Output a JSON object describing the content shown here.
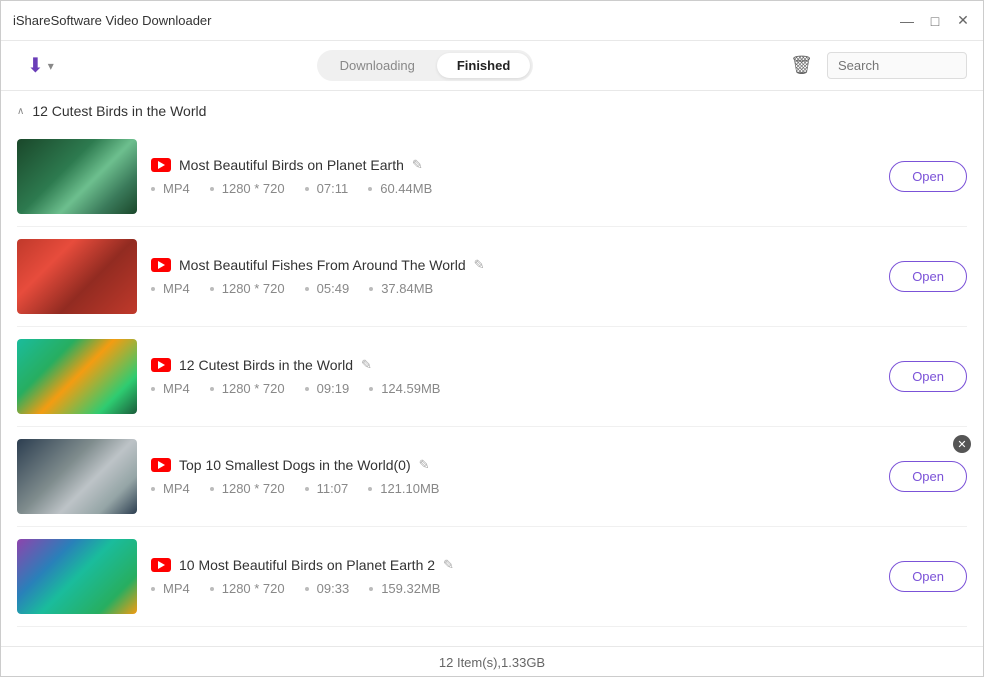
{
  "app": {
    "title": "iShareSoftware Video Downloader"
  },
  "titlebar": {
    "minimize": "—",
    "maximize": "□",
    "close": "✕"
  },
  "toolbar": {
    "downloading_label": "Downloading",
    "finished_label": "Finished",
    "active_tab": "finished",
    "search_placeholder": "Search",
    "delete_icon": "🗑"
  },
  "group": {
    "name": "12 Cutest Birds in the World",
    "collapse_icon": "∧"
  },
  "videos": [
    {
      "id": 1,
      "title": "Most Beautiful Birds on Planet Earth",
      "format": "MP4",
      "resolution": "1280 * 720",
      "duration": "07:11",
      "size": "60.44MB",
      "thumb_class": "thumb-1",
      "open_label": "Open"
    },
    {
      "id": 2,
      "title": "Most Beautiful Fishes From Around The World",
      "format": "MP4",
      "resolution": "1280 * 720",
      "duration": "05:49",
      "size": "37.84MB",
      "thumb_class": "thumb-2",
      "open_label": "Open"
    },
    {
      "id": 3,
      "title": "12 Cutest Birds in the World",
      "format": "MP4",
      "resolution": "1280 * 720",
      "duration": "09:19",
      "size": "124.59MB",
      "thumb_class": "thumb-3",
      "open_label": "Open"
    },
    {
      "id": 4,
      "title": "Top 10 Smallest Dogs in the World(0)",
      "format": "MP4",
      "resolution": "1280 * 720",
      "duration": "11:07",
      "size": "121.10MB",
      "thumb_class": "thumb-4",
      "open_label": "Open",
      "show_close": true
    },
    {
      "id": 5,
      "title": "10 Most Beautiful Birds on Planet Earth 2",
      "format": "MP4",
      "resolution": "1280 * 720",
      "duration": "09:33",
      "size": "159.32MB",
      "thumb_class": "thumb-5",
      "open_label": "Open"
    }
  ],
  "statusbar": {
    "text": "12 Item(s),1.33GB"
  }
}
